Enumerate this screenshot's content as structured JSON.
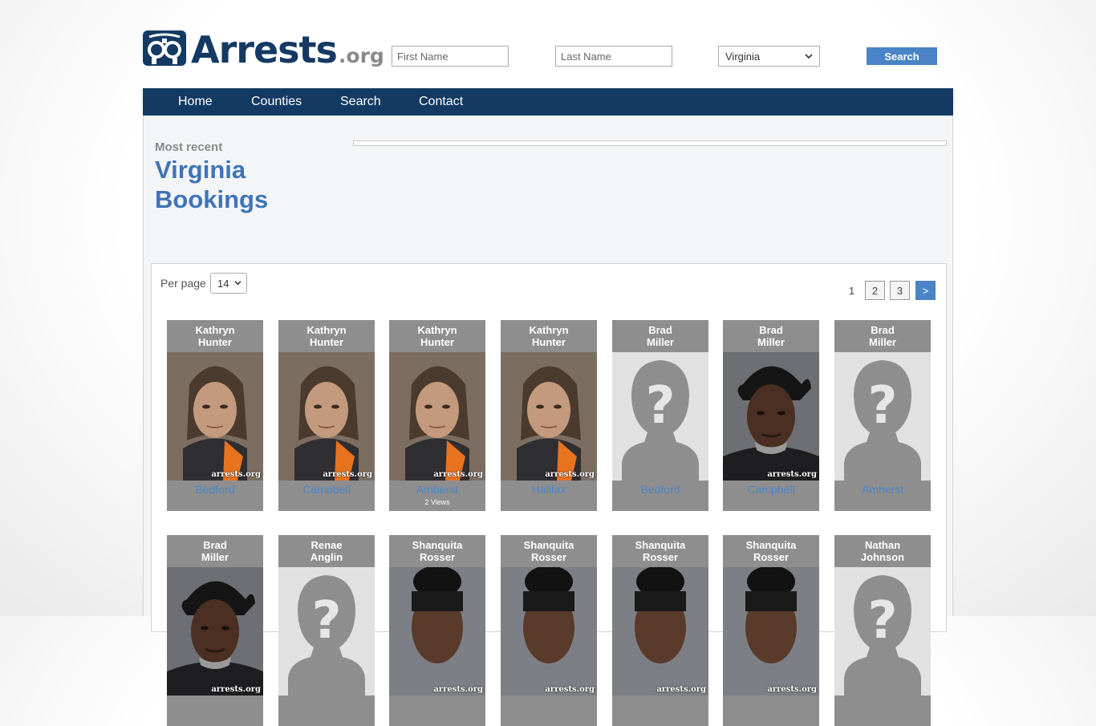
{
  "site": {
    "logo_main": "Arrests",
    "logo_org": ".org",
    "first_name_placeholder": "First Name",
    "last_name_placeholder": "Last Name",
    "state_selected": "Virginia",
    "search_label": "Search"
  },
  "nav": [
    "Home",
    "Counties",
    "Search",
    "Contact"
  ],
  "heading": {
    "kicker": "Most recent",
    "title_line1": "Virginia",
    "title_line2": "Bookings"
  },
  "listing": {
    "per_page_label": "Per page",
    "per_page_value": "14",
    "pages": [
      "1",
      "2",
      "3"
    ],
    "next_label": ">"
  },
  "cards": [
    {
      "first": "Kathryn",
      "last": "Hunter",
      "county": "Bedford",
      "views": "",
      "photo": "woman"
    },
    {
      "first": "Kathryn",
      "last": "Hunter",
      "county": "Campbell",
      "views": "",
      "photo": "woman"
    },
    {
      "first": "Kathryn",
      "last": "Hunter",
      "county": "Amherst",
      "views": "2 Views",
      "photo": "woman"
    },
    {
      "first": "Kathryn",
      "last": "Hunter",
      "county": "Halifax",
      "views": "",
      "photo": "woman"
    },
    {
      "first": "Brad",
      "last": "Miller",
      "county": "Bedford",
      "views": "",
      "photo": "placeholder"
    },
    {
      "first": "Brad",
      "last": "Miller",
      "county": "Campbell",
      "views": "",
      "photo": "man"
    },
    {
      "first": "Brad",
      "last": "Miller",
      "county": "Amherst",
      "views": "",
      "photo": "placeholder"
    },
    {
      "first": "Brad",
      "last": "Miller",
      "county": "",
      "views": "",
      "photo": "man"
    },
    {
      "first": "Renae",
      "last": "Anglin",
      "county": "",
      "views": "",
      "photo": "placeholder"
    },
    {
      "first": "Shanquita",
      "last": "Rosser",
      "county": "",
      "views": "",
      "photo": "woman2"
    },
    {
      "first": "Shanquita",
      "last": "Rosser",
      "county": "",
      "views": "",
      "photo": "woman2"
    },
    {
      "first": "Shanquita",
      "last": "Rosser",
      "county": "",
      "views": "",
      "photo": "woman2"
    },
    {
      "first": "Shanquita",
      "last": "Rosser",
      "county": "",
      "views": "",
      "photo": "woman2"
    },
    {
      "first": "Nathan",
      "last": "Johnson",
      "county": "",
      "views": "",
      "photo": "placeholder"
    }
  ],
  "watermark": "arrests.org",
  "colors": {
    "brand_navy": "#133a63",
    "link_blue": "#3f75b7",
    "card_gray": "#8f8e8e",
    "button_blue": "#4a84c6"
  }
}
